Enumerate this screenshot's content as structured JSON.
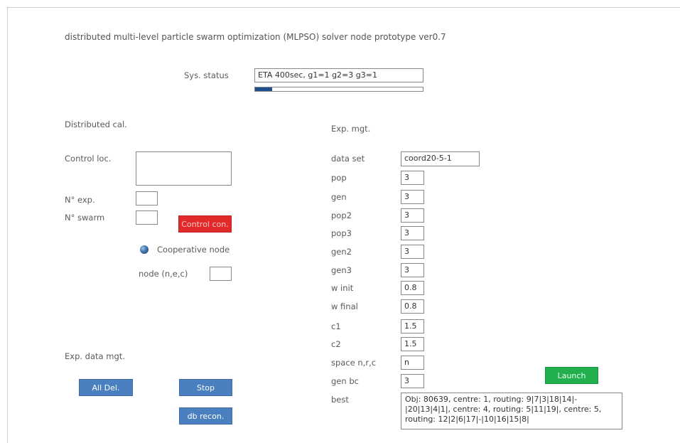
{
  "title": "distributed multi-level particle swarm optimization (MLPSO) solver node prototype ver0.7",
  "status": {
    "label": "Sys. status",
    "value": "ETA 400sec, g1=1 g2=3 g3=1",
    "progress": 0.1
  },
  "distributed": {
    "section_label": "Distributed cal.",
    "control_loc_label": "Control loc.",
    "control_loc_value": "",
    "n_exp_label": "N° exp.",
    "n_exp_value": "",
    "n_swarm_label": "N° swarm",
    "n_swarm_value": "",
    "control_con_label": "Control con.",
    "cooperative_label": "Cooperative node",
    "node_label": "node (n,e,c)",
    "node_value": ""
  },
  "exp_data": {
    "section_label": "Exp. data mgt.",
    "all_del_label": "All Del.",
    "stop_label": "Stop",
    "db_recon_label": "db recon."
  },
  "exp_mgt": {
    "section_label": "Exp.  mgt.",
    "data_set_label": "data set",
    "data_set_value": "coord20-5-1",
    "params": [
      {
        "label": "pop",
        "value": "3"
      },
      {
        "label": "gen",
        "value": "3"
      },
      {
        "label": "pop2",
        "value": "3"
      },
      {
        "label": "pop3",
        "value": "3"
      },
      {
        "label": "gen2",
        "value": "3"
      },
      {
        "label": "gen3",
        "value": "3"
      },
      {
        "label": "w init",
        "value": "0.8"
      },
      {
        "label": "w final",
        "value": "0.8"
      },
      {
        "label": "c1",
        "value": "1.5"
      },
      {
        "label": "c2",
        "value": "1.5"
      },
      {
        "label": "space n,r,c",
        "value": "n"
      },
      {
        "label": "gen bc",
        "value": "3"
      }
    ],
    "best_label": "best",
    "best_value": "Obj: 80639, centre: 1, routing: 9|7|3|18|14|-|20|13|4|1|, centre: 4, routing: 5|11|19|, centre: 5, routing: 12|2|6|17|-|10|16|15|8|",
    "launch_label": "Launch"
  }
}
